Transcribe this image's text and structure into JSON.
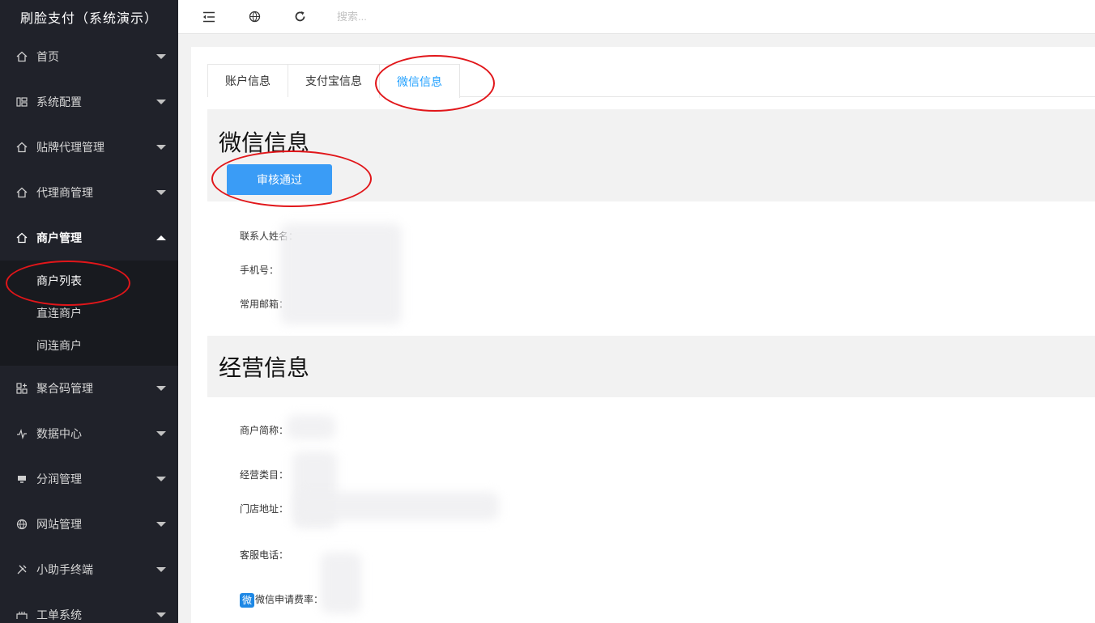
{
  "app": {
    "title": "刷脸支付（系统演示）"
  },
  "sidebar": {
    "items": [
      {
        "label": "首页",
        "icon": "home-icon"
      },
      {
        "label": "系统配置",
        "icon": "config-icon"
      },
      {
        "label": "贴牌代理管理",
        "icon": "home-icon"
      },
      {
        "label": "代理商管理",
        "icon": "home-icon"
      },
      {
        "label": "商户管理",
        "icon": "home-icon",
        "expanded": true
      },
      {
        "label": "聚合码管理",
        "icon": "qrcode-icon"
      },
      {
        "label": "数据中心",
        "icon": "pulse-icon"
      },
      {
        "label": "分润管理",
        "icon": "monitor-icon"
      },
      {
        "label": "网站管理",
        "icon": "globe-icon"
      },
      {
        "label": "小助手终端",
        "icon": "tools-icon"
      },
      {
        "label": "工单系统",
        "icon": "ticket-icon"
      }
    ],
    "submenu": [
      {
        "label": "商户列表"
      },
      {
        "label": "直连商户"
      },
      {
        "label": "间连商户"
      }
    ]
  },
  "header": {
    "search_placeholder": "搜索..."
  },
  "tabs": [
    {
      "label": "账户信息"
    },
    {
      "label": "支付宝信息"
    },
    {
      "label": "微信信息",
      "active": true
    }
  ],
  "wechat_section": {
    "title": "微信信息",
    "approve_label": "审核通过",
    "fields": [
      {
        "label": "联系人姓名：",
        "value": ""
      },
      {
        "label": "手机号：",
        "value": ""
      },
      {
        "label": "常用邮箱：",
        "value": ""
      }
    ]
  },
  "business_section": {
    "title": "经营信息",
    "fields": [
      {
        "label": "商户简称：",
        "value": ""
      },
      {
        "label": "经营类目：",
        "value": ""
      },
      {
        "label": "门店地址：",
        "value": ""
      },
      {
        "label": "客服电话：",
        "value": ""
      }
    ],
    "rate_badge": "微",
    "rate_label": "微信申请费率：",
    "rate_value": ""
  },
  "colors": {
    "sidebar_bg": "#20222a",
    "submenu_bg": "#181a1f",
    "accent": "#1e9fff",
    "button": "#3a9cf6",
    "annotation": "#e1161a"
  }
}
